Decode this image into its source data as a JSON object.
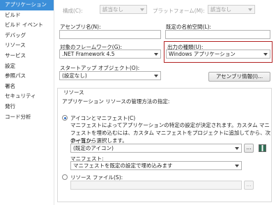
{
  "sidebar": {
    "items": [
      {
        "label": "アプリケーション",
        "active": true
      },
      {
        "label": "ビルド"
      },
      {
        "label": "ビルド イベント"
      },
      {
        "label": "デバッグ"
      },
      {
        "label": "リソース"
      },
      {
        "label": "サービス"
      },
      {
        "label": "設定"
      },
      {
        "label": "参照パス"
      },
      {
        "label": "署名"
      },
      {
        "label": "セキュリティ"
      },
      {
        "label": "発行"
      },
      {
        "label": "コード分析"
      }
    ]
  },
  "toolbar": {
    "config_label": "構成(C):",
    "config_value": "該当なし",
    "platform_label": "プラットフォーム(M):",
    "platform_value": "該当なし"
  },
  "fields": {
    "assembly_name_label": "アセンブリ名(N):",
    "assembly_name_value": "",
    "default_namespace_label": "既定の名前空間(L):",
    "default_namespace_value": "",
    "target_framework_label": "対象のフレームワーク(G):",
    "target_framework_value": ".NET Framework 4.5",
    "output_type_label": "出力の種類(U):",
    "output_type_value": "Windows アプリケーション",
    "startup_object_label": "スタートアップ オブジェクト(O):",
    "startup_object_value": "(設定なし)",
    "assembly_info_button": "アセンブリ情報(I)..."
  },
  "resources": {
    "group_title": "リソース",
    "intro": "アプリケーション リソースの管理方法の指定:",
    "icon_manifest_label": "アイコンとマニフェスト(C)",
    "icon_manifest_desc": "マニフェストによってアプリケーションの特定の設定が決定されます。カスタム マニフェストを埋め込むには、カスタム マニフェストをプロジェクトに追加してから、次の一覧から選択します。",
    "icon_label": "アイコン:",
    "icon_value": "(既定のアイコン)",
    "browse_button": "...",
    "manifest_label": "マニフェスト:",
    "manifest_value": "マニフェストを既定の設定で埋め込みます",
    "resource_file_label": "リソース ファイル(S):",
    "resource_file_value": "",
    "resource_browse_button": "..."
  },
  "colors": {
    "accent": "#3c8fd9",
    "highlight_border": "#b22222"
  }
}
